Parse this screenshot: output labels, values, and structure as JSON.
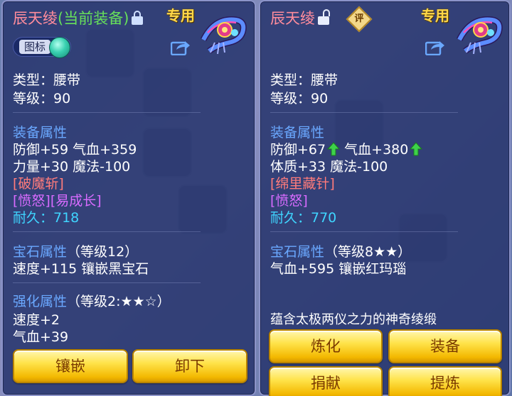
{
  "left": {
    "name": "辰天绫",
    "tag": "(当前装备)",
    "special": "专用",
    "icon_toggle_label": "图标",
    "type_line": "类型：腰带",
    "level_line": "等级：90",
    "attr_title": "装备属性",
    "attr_line1": "防御+59 气血+359",
    "attr_line2": "力量+30 魔法-100",
    "skill1": "[破魔斩]",
    "skill2": "[愤怒][易成长]",
    "durability": "耐久：718",
    "gem_title": "宝石属性",
    "gem_level": "（等级12）",
    "gem_line": "速度+115 镶嵌黑宝石",
    "enhance_title": "强化属性",
    "enhance_level": "（等级2:★★☆）",
    "enhance_line1": "速度+2",
    "enhance_line2": "气血+39",
    "buttons": [
      "镶嵌",
      "卸下"
    ]
  },
  "right": {
    "name": "辰天绫",
    "badge": "评",
    "special": "专用",
    "type_line": "类型：腰带",
    "level_line": "等级：90",
    "attr_title": "装备属性",
    "attr_def": "防御+67",
    "attr_hp": "气血+380",
    "attr_line2": "体质+33 魔法-100",
    "skill1": "[绵里藏针]",
    "skill2": "[愤怒]",
    "durability": "耐久：770",
    "gem_title": "宝石属性",
    "gem_level": "（等级8★★）",
    "gem_line": "气血+595 镶嵌红玛瑙",
    "desc": "蕴含太极两仪之力的神奇绫缎",
    "buttons": [
      "炼化",
      "装备",
      "捐献",
      "提炼"
    ]
  },
  "colors": {
    "accent_gold": "#ffd84a",
    "name_pink": "#ff8c9c",
    "tag_green": "#67e05a",
    "label_blue": "#6aa8ff",
    "value_cyan": "#3fd5ff",
    "skill_red": "#ff7b7b",
    "skill_pink": "#d86bff"
  },
  "icons": [
    "lock-icon",
    "unlock-icon",
    "share-icon",
    "belt-item-icon",
    "up-arrow-icon",
    "rating-badge-icon"
  ]
}
